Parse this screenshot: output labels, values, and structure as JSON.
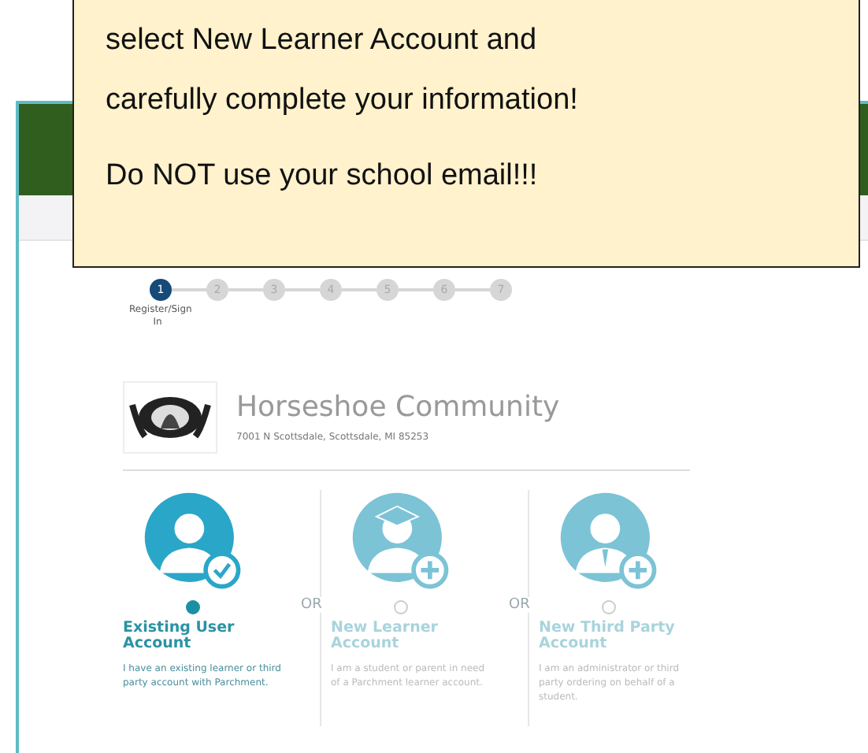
{
  "callout": {
    "lines": [
      "select New Learner Account and",
      "carefully complete your information!",
      "Do NOT use your school email!!!"
    ]
  },
  "steps": [
    {
      "label": "1",
      "selected": true
    },
    {
      "label": "2",
      "selected": false
    },
    {
      "label": "3",
      "selected": false
    },
    {
      "label": "4",
      "selected": false
    },
    {
      "label": "5",
      "selected": false
    },
    {
      "label": "6",
      "selected": false
    },
    {
      "label": "7",
      "selected": false
    }
  ],
  "step_caption": "Register/Sign In",
  "school": {
    "name": "Horseshoe Community",
    "address": "7001 N Scottsdale, Scottsdale, MI 85253"
  },
  "options": [
    {
      "kind": "existing",
      "title": "Existing User Account",
      "description": "I have an existing learner or third party account with Parchment.",
      "selected": true
    },
    {
      "kind": "learner",
      "title": "New Learner Account",
      "description": "I am a student or parent in need of a Parchment learner account.",
      "selected": false
    },
    {
      "kind": "third_party",
      "title": "New Third Party Account",
      "description": "I am an administrator or third party ordering on behalf of a student.",
      "selected": false
    }
  ],
  "separators": [
    "OR",
    "OR"
  ]
}
